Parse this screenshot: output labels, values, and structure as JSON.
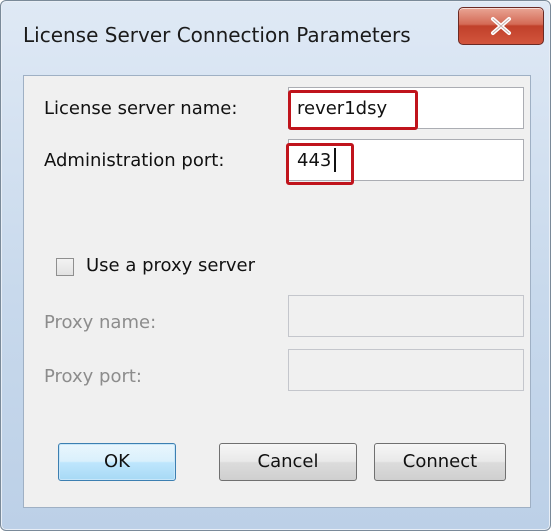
{
  "window": {
    "title": "License Server Connection Parameters"
  },
  "fields": {
    "server_name": {
      "label": "License server name:",
      "value": "rever1dsy"
    },
    "admin_port": {
      "label": "Administration port:",
      "value": "443"
    },
    "use_proxy": {
      "label": "Use a proxy server",
      "checked": false
    },
    "proxy_name": {
      "label": "Proxy name:",
      "value": ""
    },
    "proxy_port": {
      "label": "Proxy port:",
      "value": ""
    }
  },
  "buttons": {
    "ok": "OK",
    "cancel": "Cancel",
    "connect": "Connect"
  },
  "icons": {
    "close": "close-icon"
  },
  "colors": {
    "highlight": "#c0141c",
    "close_button": "#c9452f",
    "default_button_border": "#3c7fb1"
  }
}
